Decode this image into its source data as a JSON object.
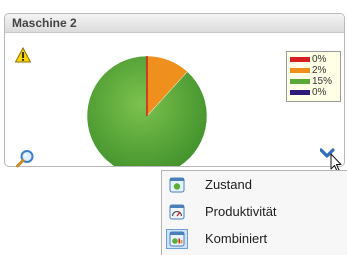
{
  "panel": {
    "title": "Maschine 2"
  },
  "chart_data": {
    "type": "pie",
    "categories": [
      "red",
      "orange",
      "green",
      "purple"
    ],
    "values": [
      0,
      2,
      15,
      0
    ],
    "labels": [
      "0%",
      "2%",
      "15%",
      "0%"
    ],
    "colors": [
      "#d42020",
      "#f0901c",
      "#5aa83a",
      "#2e1a7a"
    ]
  },
  "legend": {
    "items": [
      {
        "label": "0%",
        "color": "#d42020"
      },
      {
        "label": "2%",
        "color": "#f0901c"
      },
      {
        "label": "15%",
        "color": "#5aa83a"
      },
      {
        "label": "0%",
        "color": "#2e1a7a"
      }
    ]
  },
  "icons": {
    "warning": "warning-icon",
    "zoom": "magnifier-icon",
    "toggle": "chevron-down-icon"
  },
  "menu": {
    "items": [
      {
        "label": "Zustand",
        "icon": "state-icon"
      },
      {
        "label": "Produktivität",
        "icon": "gauge-icon"
      },
      {
        "label": "Kombiniert",
        "icon": "combined-icon",
        "selected": true
      }
    ]
  }
}
